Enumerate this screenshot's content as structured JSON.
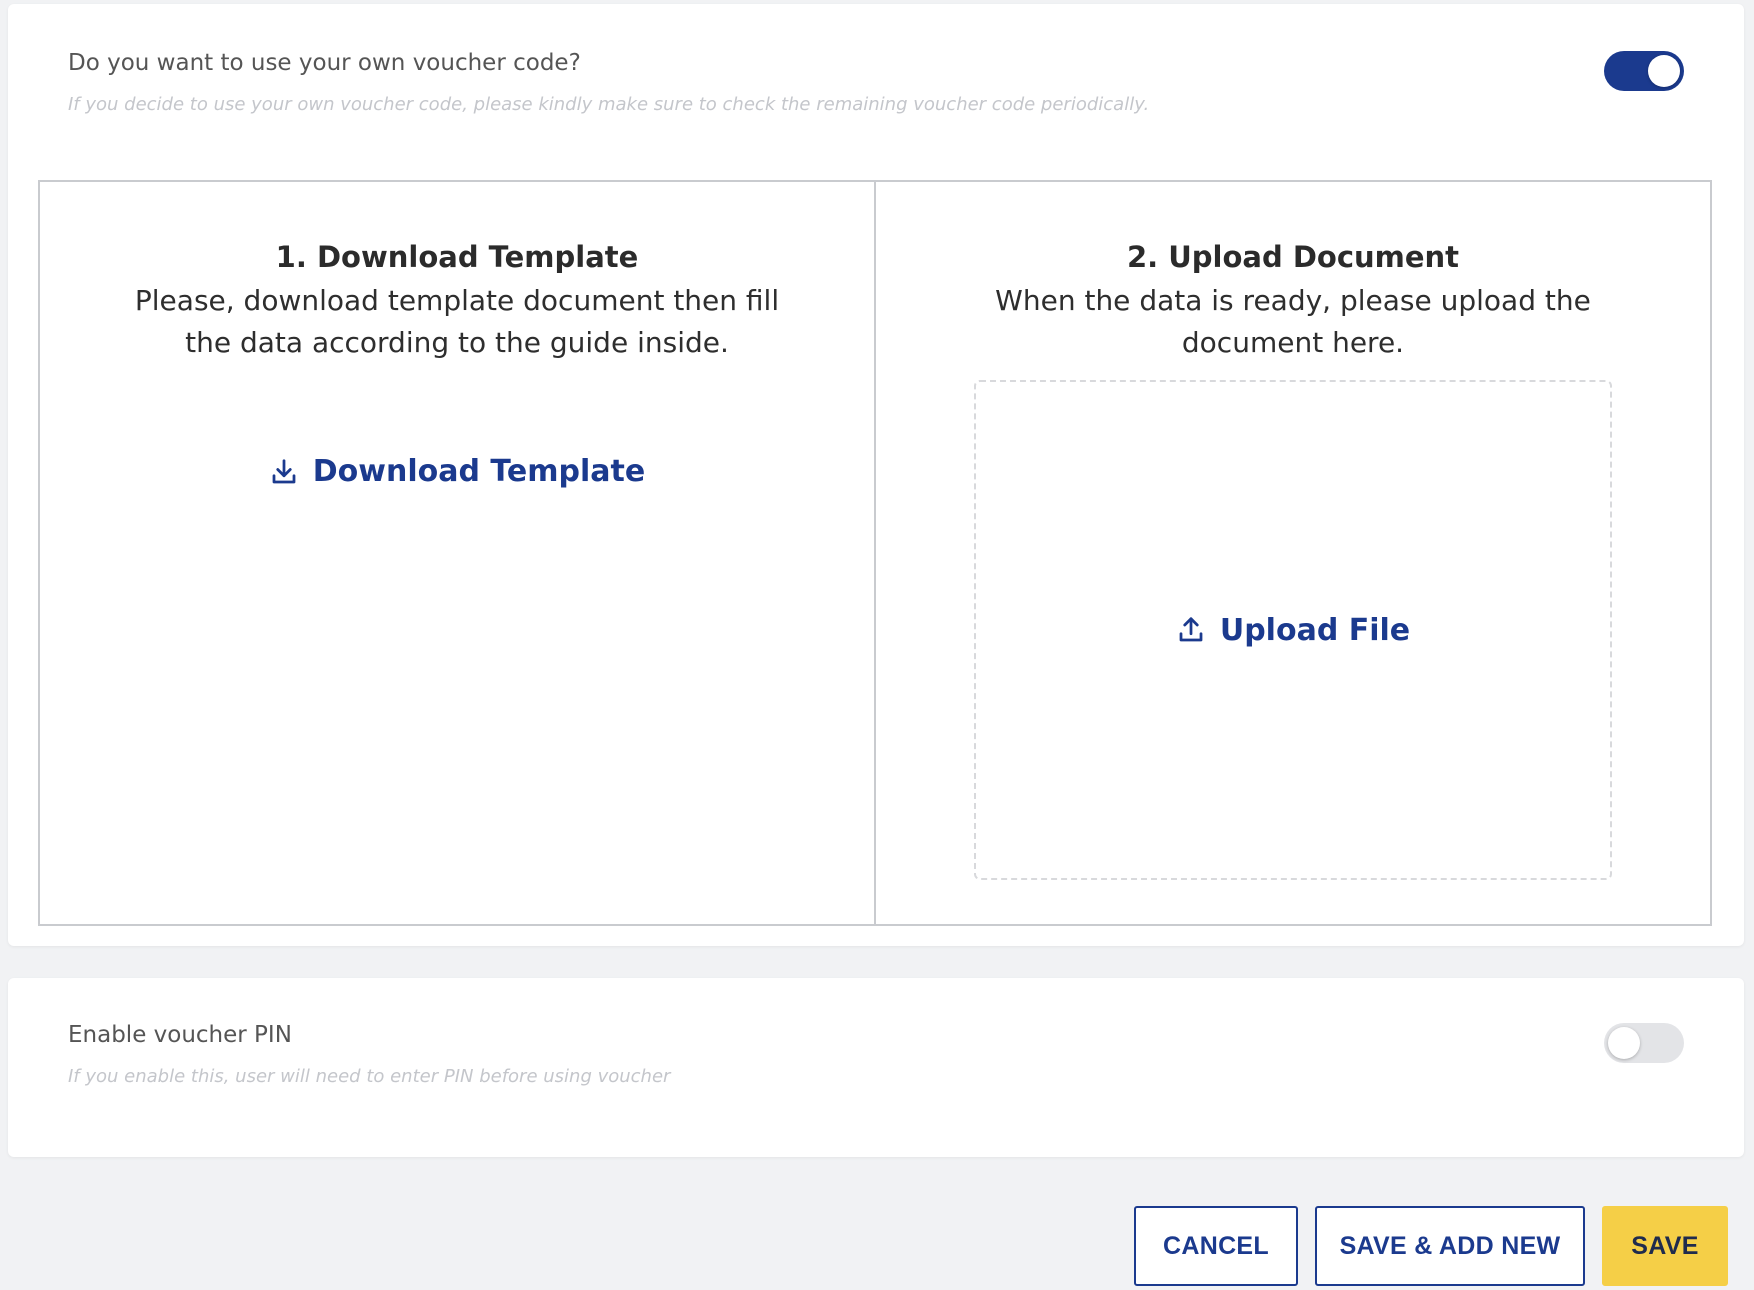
{
  "own_code": {
    "title": "Do you want to use your own voucher code?",
    "hint": "If you decide to use your own voucher code, please kindly make sure to check the remaining voucher code periodically.",
    "toggle_on": true
  },
  "download_panel": {
    "title": "1. Download Template",
    "description": "Please, download template document then fill the data according to the guide inside.",
    "link_label": "Download Template",
    "icon": "download-icon"
  },
  "upload_panel": {
    "title": "2. Upload Document",
    "description": "When the data is ready, please upload the document here.",
    "link_label": "Upload File",
    "icon": "upload-icon"
  },
  "pin": {
    "title": "Enable voucher PIN",
    "hint": "If you enable this, user will need to enter PIN before using voucher",
    "toggle_on": false
  },
  "actions": {
    "cancel": "CANCEL",
    "save_add_new": "SAVE & ADD NEW",
    "save": "SAVE"
  },
  "colors": {
    "accent": "#1b3a8e",
    "primary_button": "#f5cf47",
    "toggle_off": "#e3e4e7"
  }
}
